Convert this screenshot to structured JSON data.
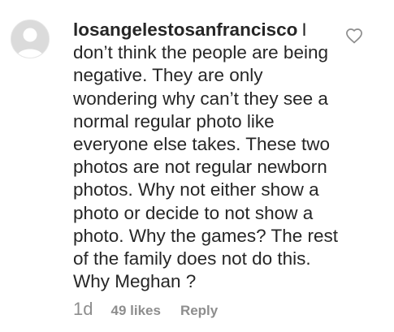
{
  "comment": {
    "username": "losangelestosanfrancisco",
    "text": "I don’t think the people are being negative. They are only wondering why can’t they see a normal regular photo like everyone else takes. These two photos are not regular newborn photos. Why not either show a photo or decide to not show a photo. Why the games? The rest of the family does not do this. Why Meghan ?",
    "time": "1d",
    "likes": "49 likes",
    "reply_label": "Reply",
    "avatar_icon": "default-avatar-icon",
    "like_icon": "heart-outline-icon"
  },
  "colors": {
    "text": "#262626",
    "secondary": "#8e8e8e",
    "avatar_bg": "#dbdbdb"
  }
}
